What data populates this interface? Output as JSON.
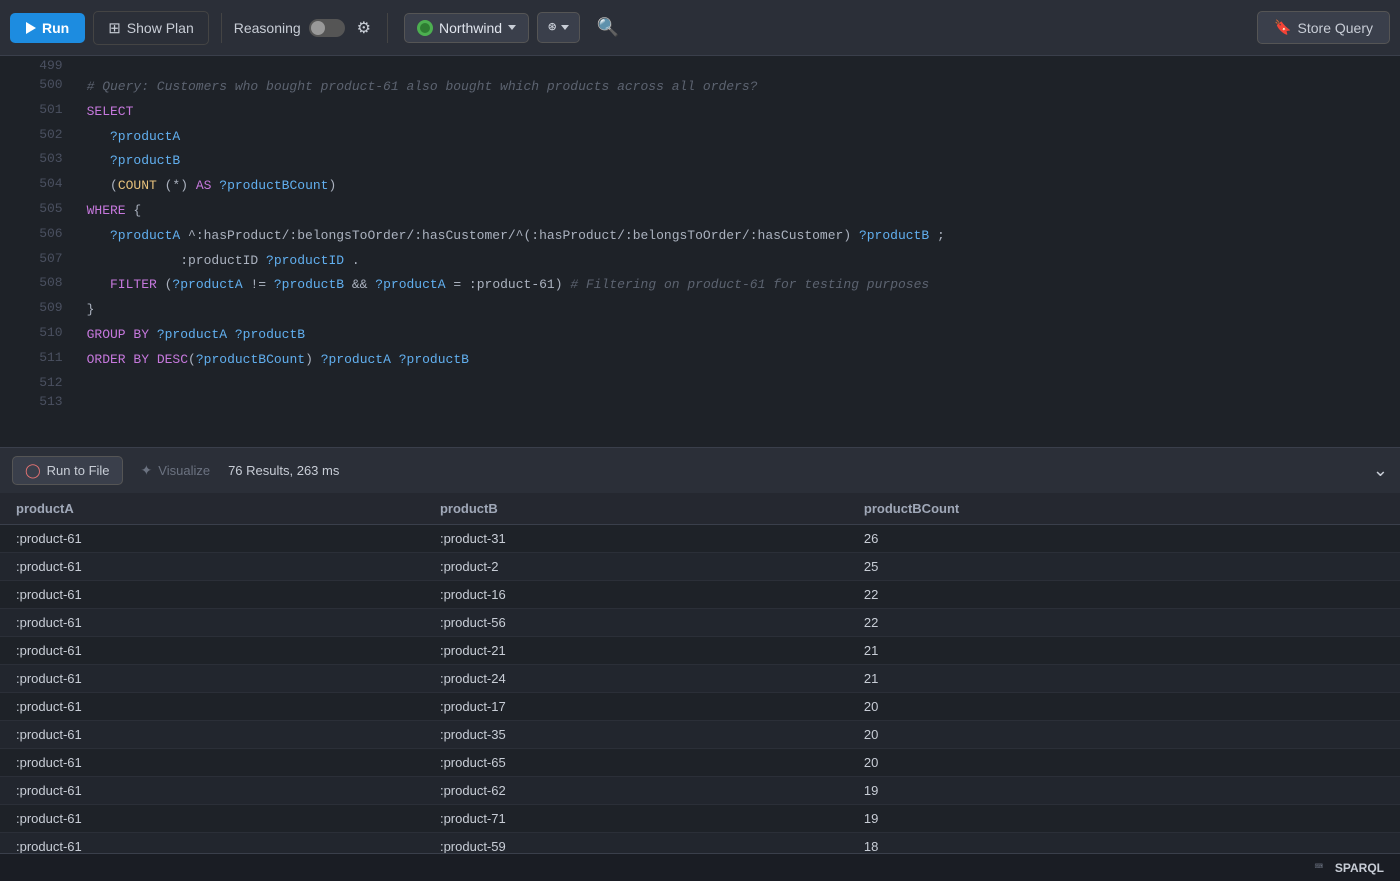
{
  "toolbar": {
    "run_label": "Run",
    "show_plan_label": "Show Plan",
    "reasoning_label": "Reasoning",
    "db_name": "Northwind",
    "store_query_label": "Store Query"
  },
  "bottom_bar": {
    "run_to_file_label": "Run to File",
    "visualize_label": "Visualize",
    "results_info": "76 Results,  263 ms"
  },
  "code": {
    "lines": [
      {
        "num": "499",
        "html": ""
      },
      {
        "num": "500",
        "text": "# Query: Customers who bought product-61 also bought which products across all orders?"
      },
      {
        "num": "501",
        "text": "SELECT"
      },
      {
        "num": "502",
        "text": "   ?productA"
      },
      {
        "num": "503",
        "text": "   ?productB"
      },
      {
        "num": "504",
        "text": "   (COUNT (*) AS ?productBCount)"
      },
      {
        "num": "505",
        "text": "WHERE {"
      },
      {
        "num": "506",
        "text": "   ?productA ^:hasProduct/:belongsToOrder/:hasCustomer/^(:hasProduct/:belongsToOrder/:hasCustomer) ?productB ;"
      },
      {
        "num": "507",
        "text": "            :productID ?productID ."
      },
      {
        "num": "508",
        "text": "   FILTER (?productA != ?productB && ?productA = :product-61) # Filtering on product-61 for testing purposes"
      },
      {
        "num": "509",
        "text": "}"
      },
      {
        "num": "510",
        "text": "GROUP BY ?productA ?productB"
      },
      {
        "num": "511",
        "text": "ORDER BY DESC(?productBCount) ?productA ?productB"
      },
      {
        "num": "512",
        "text": ""
      },
      {
        "num": "513",
        "text": ""
      }
    ]
  },
  "results": {
    "columns": [
      "productA",
      "productB",
      "productBCount"
    ],
    "rows": [
      [
        ":product-61",
        ":product-31",
        "26"
      ],
      [
        ":product-61",
        ":product-2",
        "25"
      ],
      [
        ":product-61",
        ":product-16",
        "22"
      ],
      [
        ":product-61",
        ":product-56",
        "22"
      ],
      [
        ":product-61",
        ":product-21",
        "21"
      ],
      [
        ":product-61",
        ":product-24",
        "21"
      ],
      [
        ":product-61",
        ":product-17",
        "20"
      ],
      [
        ":product-61",
        ":product-35",
        "20"
      ],
      [
        ":product-61",
        ":product-65",
        "20"
      ],
      [
        ":product-61",
        ":product-62",
        "19"
      ],
      [
        ":product-61",
        ":product-71",
        "19"
      ],
      [
        ":product-61",
        ":product-59",
        "18"
      ]
    ]
  },
  "status_bar": {
    "sparql_label": "SPARQL"
  }
}
